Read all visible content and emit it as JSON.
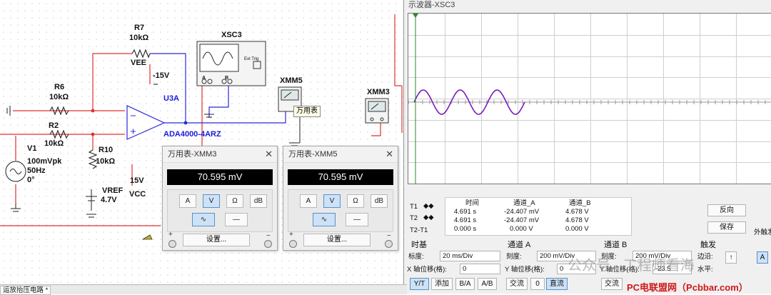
{
  "schematic": {
    "components": {
      "r7": {
        "name": "R7",
        "value": "10kΩ"
      },
      "r6": {
        "name": "R6",
        "value": "10kΩ"
      },
      "r2": {
        "name": "R2",
        "value": "10kΩ"
      },
      "r10": {
        "name": "R10",
        "value": "10kΩ"
      },
      "v1": {
        "name": "V1",
        "amp": "100mVpk",
        "freq": "50Hz",
        "phase": "0°"
      },
      "vref": {
        "name": "VREF",
        "value": "4.7V"
      },
      "vee": {
        "name": "VEE",
        "value": "-15V"
      },
      "vcc": {
        "name": "VCC",
        "value": "15V"
      },
      "u3a": {
        "name": "U3A",
        "part": "ADA4000-4ARZ"
      },
      "xsc3": {
        "name": "XSC3",
        "ext_trig": "Ext Trig",
        "a": "A",
        "b": "B"
      },
      "xmm5": {
        "name": "XMM5"
      },
      "xmm3": {
        "name": "XMM3"
      }
    },
    "tooltip": "万用表"
  },
  "meters": [
    {
      "title": "万用表-XMM3",
      "reading": "70.595 mV",
      "btn_a": "A",
      "btn_v": "V",
      "btn_ohm": "Ω",
      "btn_db": "dB",
      "settings": "设置...",
      "plus": "+",
      "minus": "−"
    },
    {
      "title": "万用表-XMM5",
      "reading": "70.595 mV",
      "btn_a": "A",
      "btn_v": "V",
      "btn_ohm": "Ω",
      "btn_db": "dB",
      "settings": "设置...",
      "plus": "+",
      "minus": "−"
    }
  ],
  "scope": {
    "title": "示波器-XSC3",
    "cursor_table": {
      "headers": [
        "时间",
        "通道_A",
        "通道_B"
      ],
      "rows": [
        {
          "label": "T1",
          "time": "4.691 s",
          "a": "-24.407 mV",
          "b": "4.678 V"
        },
        {
          "label": "T2",
          "time": "4.691 s",
          "a": "-24.407 mV",
          "b": "4.678 V"
        },
        {
          "label": "T2-T1",
          "time": "0.000 s",
          "a": "0.000 V",
          "b": "0.000 V"
        }
      ]
    },
    "reverse_btn": "反向",
    "save_btn": "保存",
    "ext_trigger": "外触发",
    "timebase": {
      "header": "时基",
      "scale_label": "标度:",
      "scale": "20 ms/Div",
      "xpos_label": "X 轴位移(格):",
      "xpos": "0",
      "yt": "Y/T",
      "add": "添加",
      "ba": "B/A",
      "ab": "A/B"
    },
    "chA": {
      "header": "通道 A",
      "scale_label": "刻度:",
      "scale": "200 mV/Div",
      "ypos_label": "Y 轴位移(格):",
      "ypos": "0",
      "ac": "交流",
      "zero": "0",
      "dc": "直流"
    },
    "chB": {
      "header": "通道 B",
      "scale_label": "刻度:",
      "scale": "200 mV/Div",
      "ypos_label": "Y 轴位移(格):",
      "ypos": "-23.5",
      "ac": "交流"
    },
    "trigger": {
      "header": "触发",
      "edge_label": "边沿:",
      "level_label": "水平:"
    }
  },
  "taskbar": {
    "tab": "运放抬压电路 *"
  },
  "watermark": {
    "site": "PC电联盟网（Pcbbar.com）",
    "account": "公众号 · 工程师看海"
  },
  "colors": {
    "wire_red": "#e03030",
    "wire_blue": "#2a2ad8",
    "trace_a": "#7a1bb5"
  }
}
